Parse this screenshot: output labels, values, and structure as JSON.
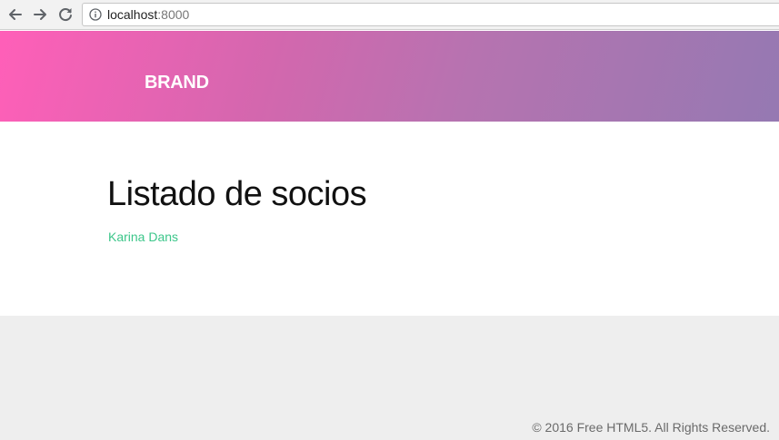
{
  "browser": {
    "url_host": "localhost",
    "url_port": ":8000"
  },
  "header": {
    "brand": "BRAND"
  },
  "main": {
    "title": "Listado de socios",
    "members": [
      "Karina Dans"
    ]
  },
  "footer": {
    "copyright": "© 2016 Free HTML5. All Rights Reserved."
  },
  "colors": {
    "gradient_start": "#ff5fb8",
    "gradient_end": "#9579b2",
    "link": "#3cc68a",
    "footer_bg": "#eeeeee"
  },
  "icons": [
    "back-arrow-icon",
    "forward-arrow-icon",
    "reload-icon",
    "info-icon"
  ]
}
